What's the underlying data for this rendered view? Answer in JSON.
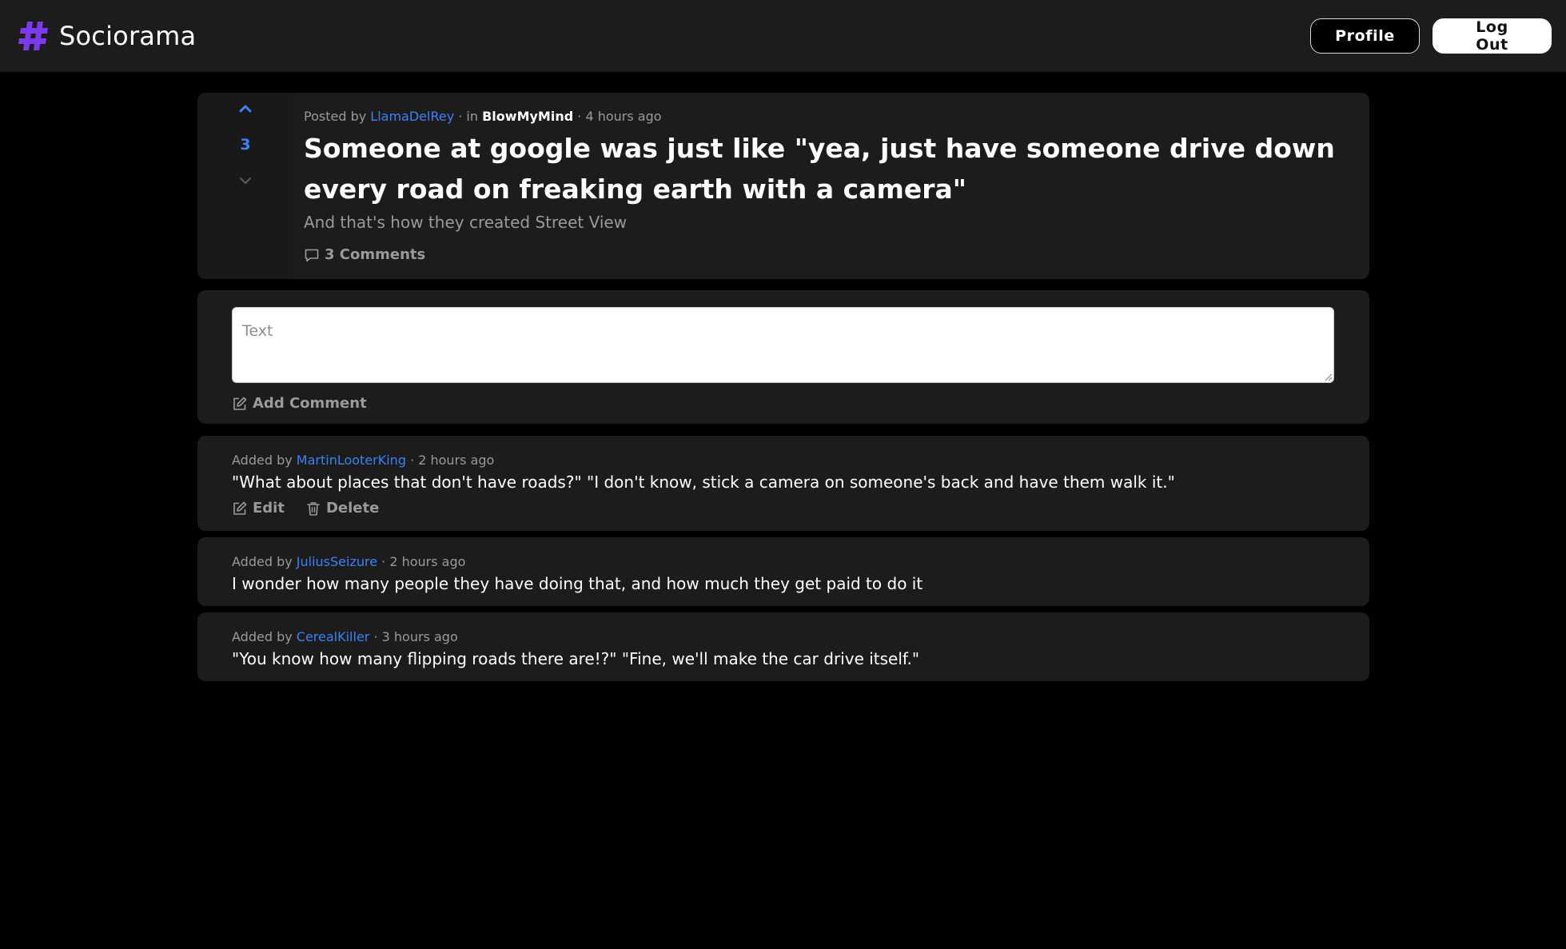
{
  "app": {
    "name": "Sociorama",
    "accent_color": "#7c3aed",
    "link_color": "#3b82f6",
    "logo_icon": "hashtag-icon"
  },
  "header": {
    "profile_label": "Profile",
    "logout_label": "Log Out"
  },
  "post": {
    "votes": "3",
    "meta_prefix": "Posted by",
    "author": "LlamaDelRey",
    "in_text": "· in",
    "subreddit": "BlowMyMind",
    "time": "· 4 hours ago",
    "title": "Someone at google was just like \"yea, just have someone drive down every road on freaking earth with a camera\"",
    "body": "And that's how they created Street View",
    "comments_label": "3 Comments"
  },
  "composer": {
    "placeholder": "Text",
    "submit_label": "Add Comment"
  },
  "comments": [
    {
      "meta_prefix": "Added by",
      "author": "MartinLooterKing",
      "time": "· 2 hours ago",
      "text": "\"What about places that don't have roads?\" \"I don't know, stick a camera on someone's back and have them walk it.\"",
      "edit_label": "Edit",
      "delete_label": "Delete"
    },
    {
      "meta_prefix": "Added by",
      "author": "JuliusSeizure",
      "time": "· 2 hours ago",
      "text": "I wonder how many people they have doing that, and how much they get paid to do it"
    },
    {
      "meta_prefix": "Added by",
      "author": "CerealKiller",
      "time": "· 3 hours ago",
      "text": "\"You know how many flipping roads there are!?\" \"Fine, we'll make the car drive itself.\""
    }
  ]
}
